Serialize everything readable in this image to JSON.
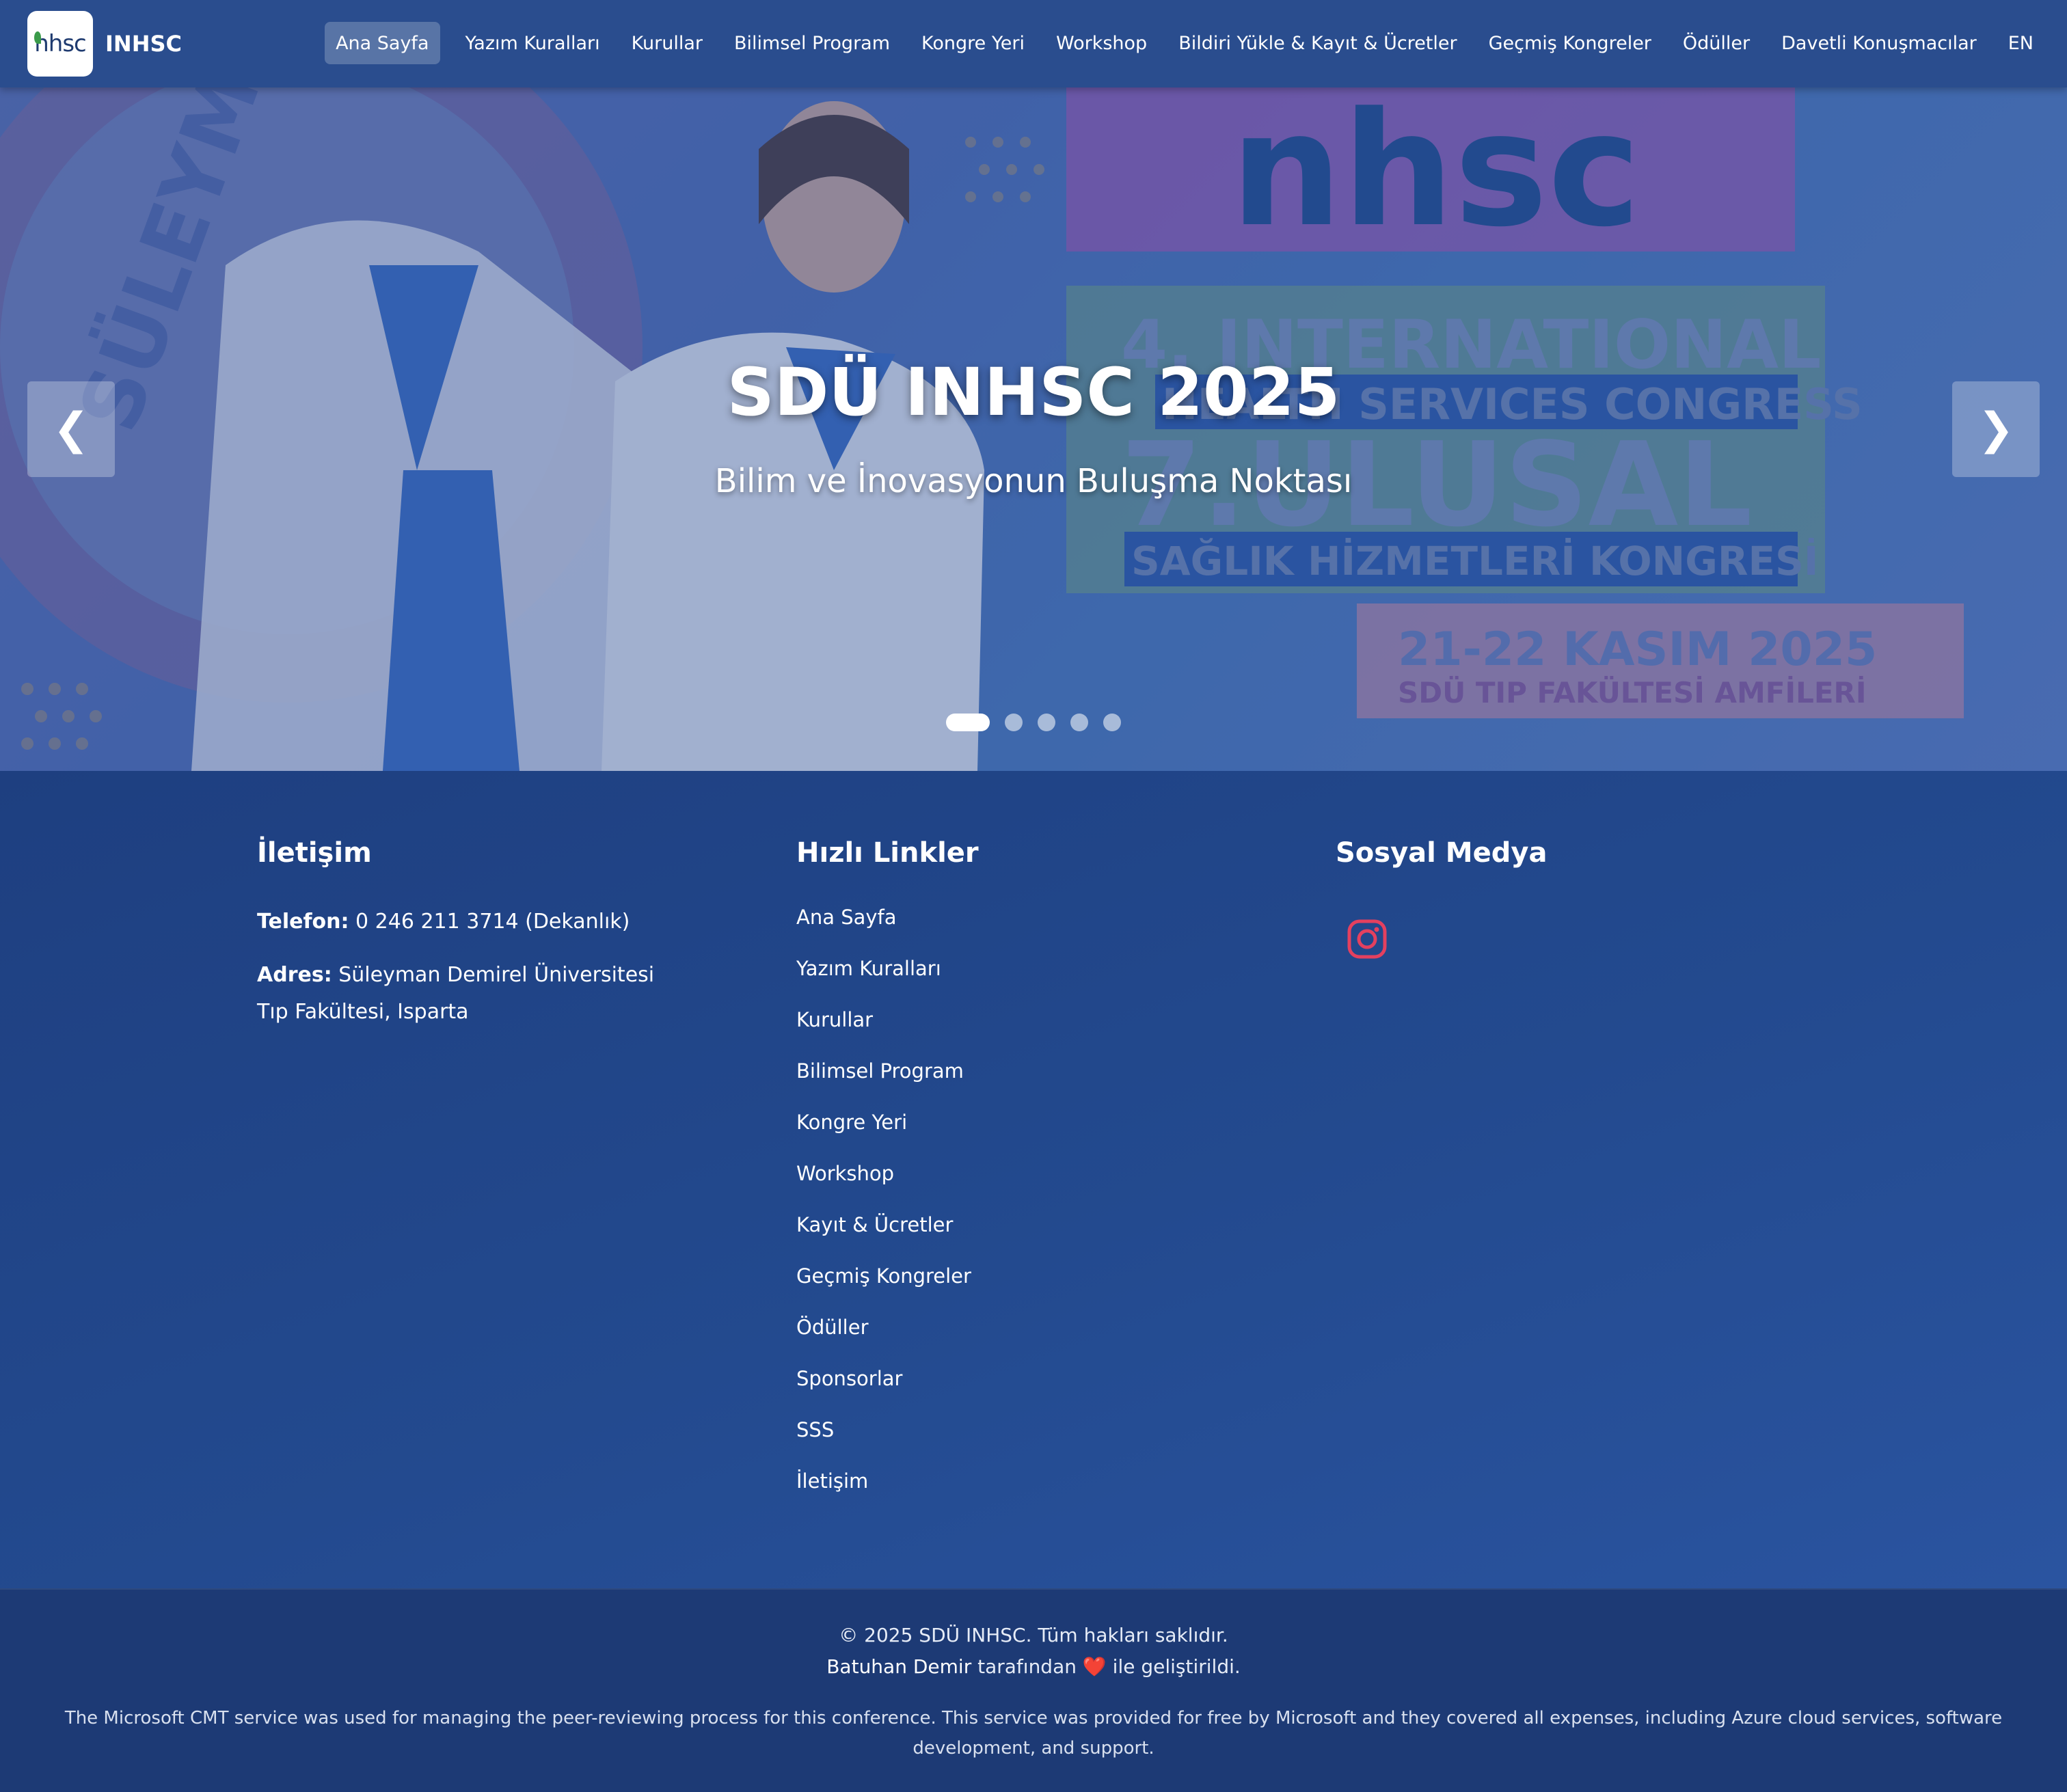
{
  "brand": {
    "logo_text": "nhsc",
    "name": "INHSC"
  },
  "nav": {
    "items": [
      {
        "label": "Ana Sayfa",
        "active": true
      },
      {
        "label": "Yazım Kuralları"
      },
      {
        "label": "Kurullar"
      },
      {
        "label": "Bilimsel Program"
      },
      {
        "label": "Kongre Yeri"
      },
      {
        "label": "Workshop"
      },
      {
        "label": "Bildiri Yükle & Kayıt & Ücretler"
      },
      {
        "label": "Geçmiş Kongreler"
      },
      {
        "label": "Ödüller"
      },
      {
        "label": "Davetli Konuşmacılar"
      },
      {
        "label": "EN"
      }
    ]
  },
  "hero": {
    "title": "SDÜ INHSC 2025",
    "subtitle": "Bilim ve İnovasyonun Buluşma Noktası",
    "prev_icon": "❮",
    "next_icon": "❯",
    "slide_count": 5,
    "active_slide": 1,
    "banner": {
      "logo": "nhsc",
      "line1": "4. INTERNATIONAL",
      "line2": "HEALTH SERVICES CONGRESS",
      "line3": "7.ULUSAL",
      "line4": "SAĞLIK HİZMETLERİ KONGRESİ",
      "date": "21-22 KASIM 2025",
      "venue": "SDÜ TIP FAKÜLTESİ AMFİLERİ",
      "seal_text": "SÜLEYMAN"
    }
  },
  "footer": {
    "contact": {
      "heading": "İletişim",
      "phone_label": "Telefon:",
      "phone_value": "0 246 211 3714 (Dekanlık)",
      "address_label": "Adres:",
      "address_line1": "Süleyman Demirel Üniversitesi",
      "address_line2": "Tıp Fakültesi, Isparta"
    },
    "quick_links": {
      "heading": "Hızlı Linkler",
      "items": [
        "Ana Sayfa",
        "Yazım Kuralları",
        "Kurullar",
        "Bilimsel Program",
        "Kongre Yeri",
        "Workshop",
        "Kayıt & Ücretler",
        "Geçmiş Kongreler",
        "Ödüller",
        "Sponsorlar",
        "SSS",
        "İletişim"
      ]
    },
    "social": {
      "heading": "Sosyal Medya",
      "icon": "instagram-icon",
      "icon_color": "#e4405f"
    },
    "bottom": {
      "copyright": "© 2025 SDÜ INHSC. Tüm hakları saklıdır.",
      "credit_name": "Batuhan Demir",
      "credit_mid": " tarafından ",
      "heart": "❤️",
      "credit_end": " ile geliştirildi.",
      "cmt_notice": "The Microsoft CMT service was used for managing the peer-reviewing process for this conference. This service was provided for free by Microsoft and they covered all expenses, including Azure cloud services, software development, and support."
    }
  }
}
